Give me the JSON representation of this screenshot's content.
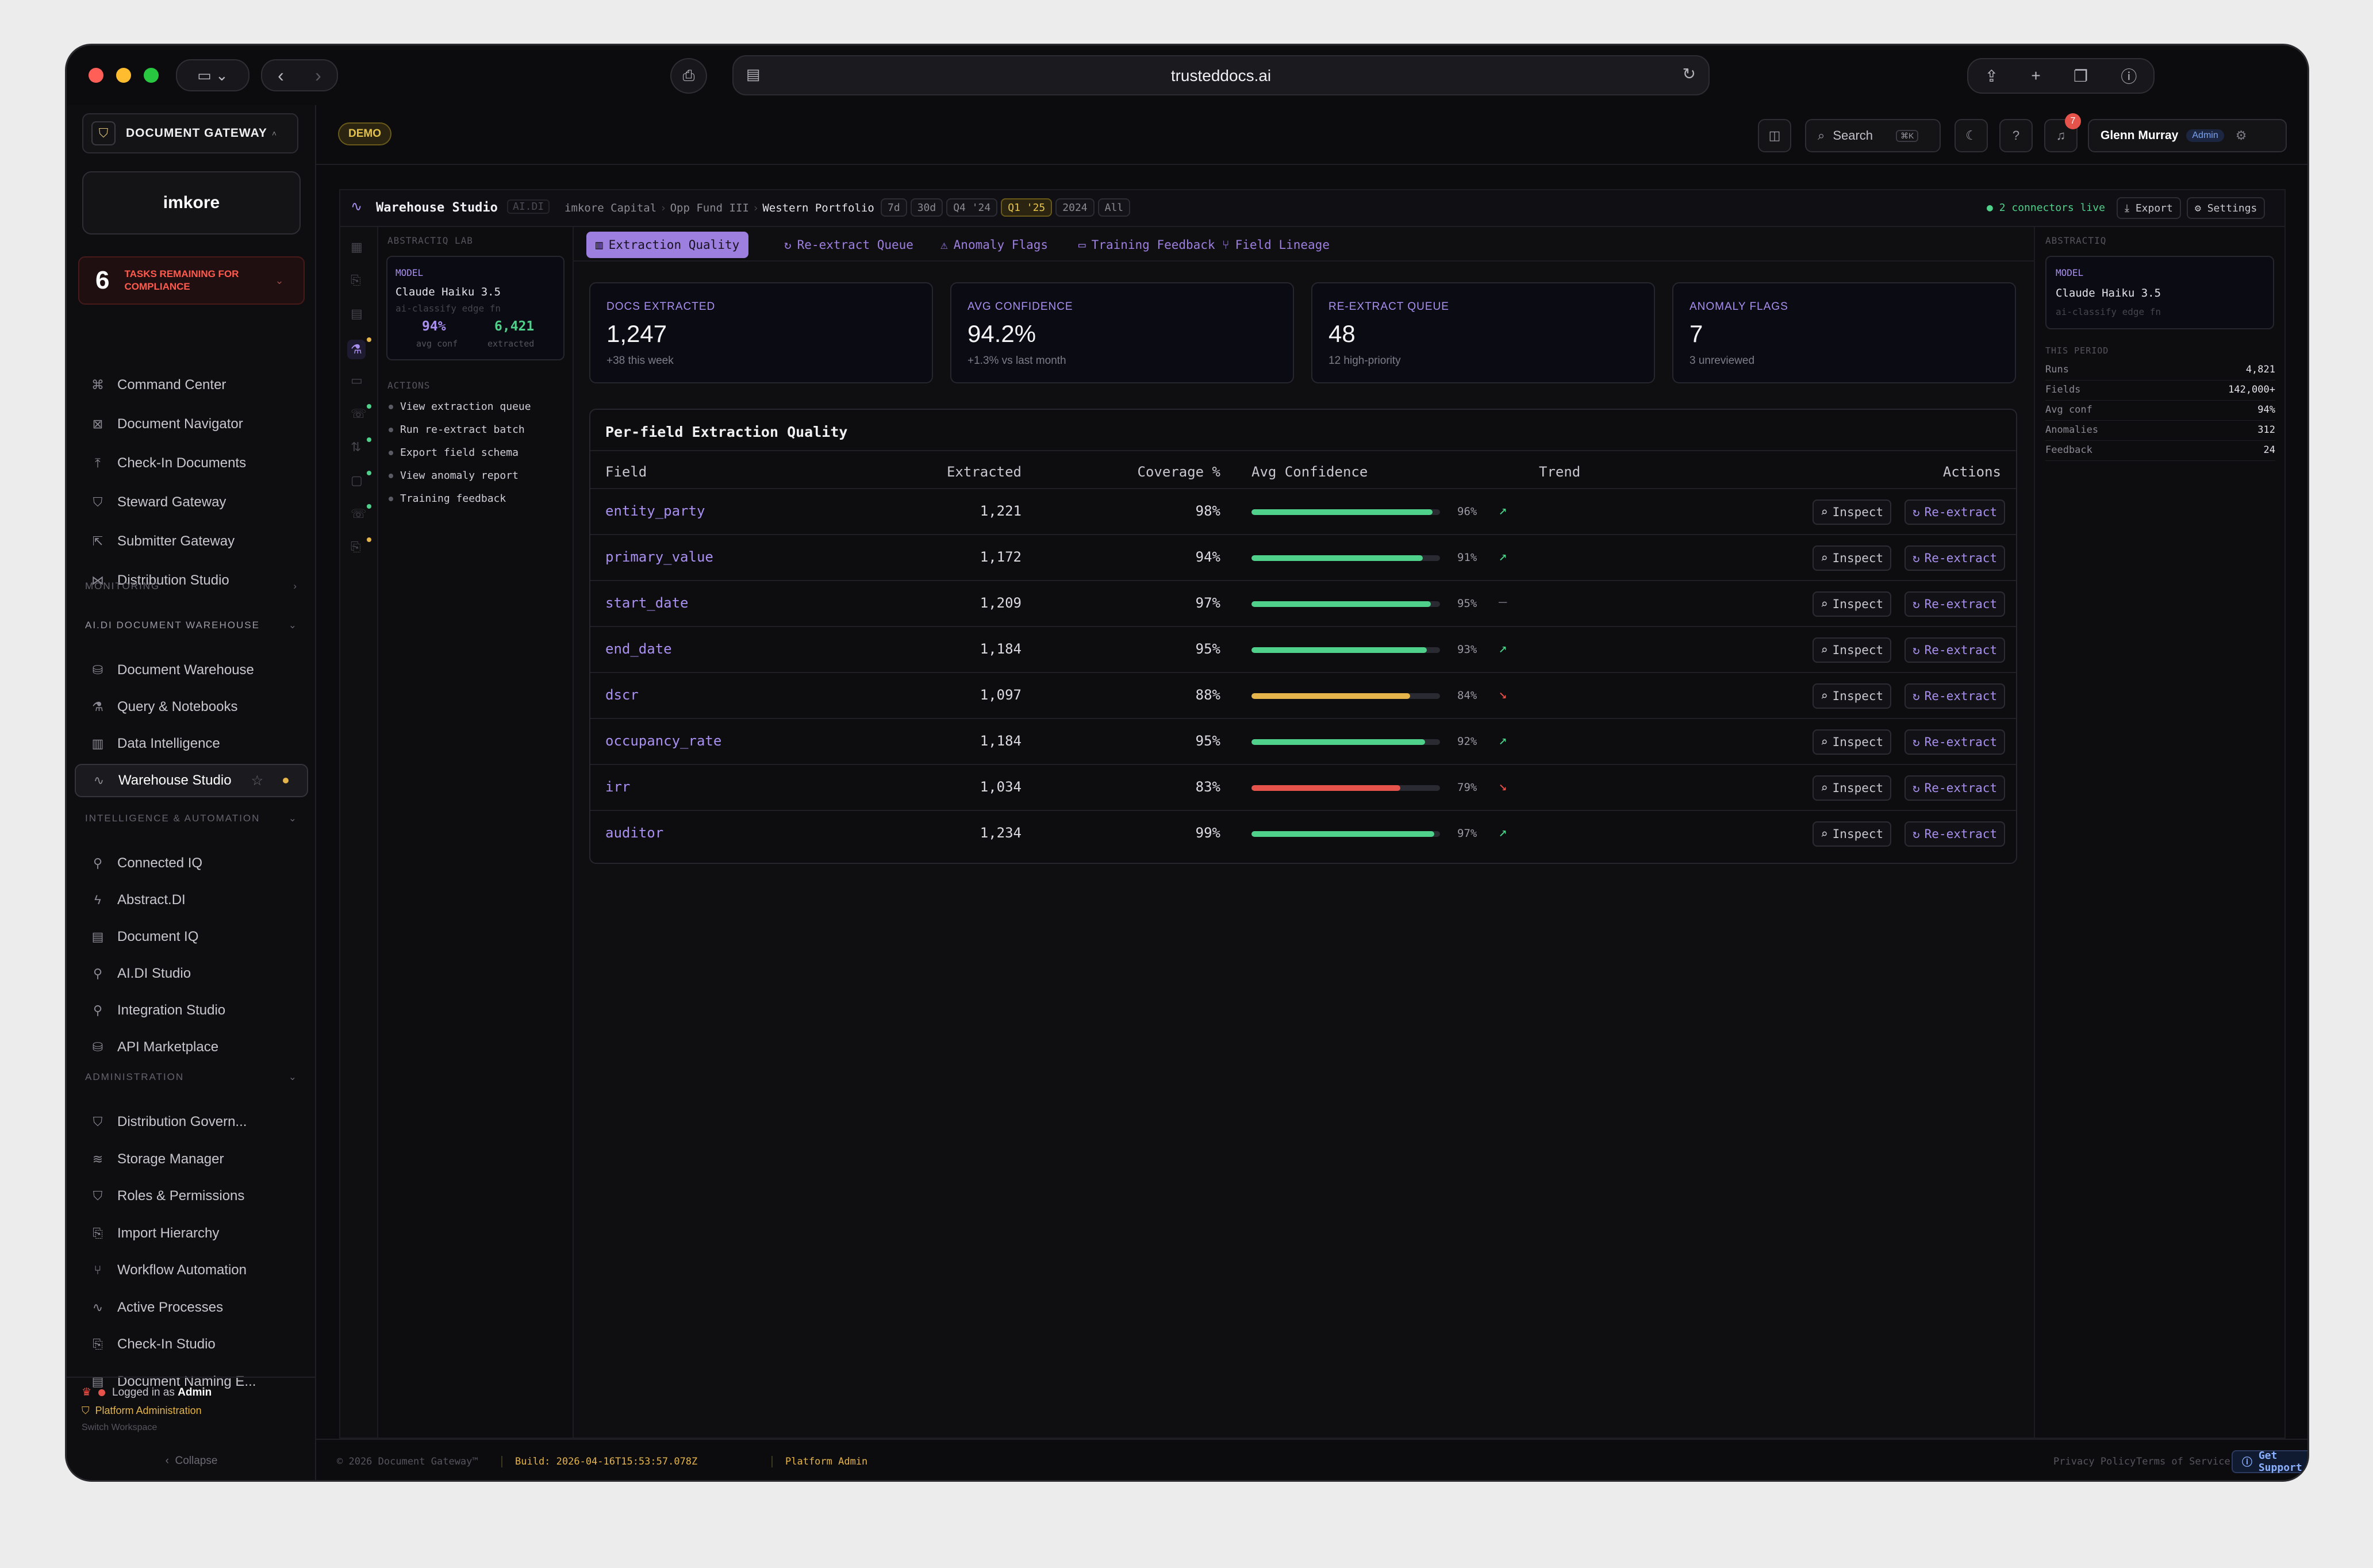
{
  "browser": {
    "url": "trusteddocs.ai"
  },
  "app": {
    "brand": "DOCUMENT GATEWAY",
    "env_badge": "DEMO",
    "logo_text": "imkore"
  },
  "tasks": {
    "count": "6",
    "label": "TASKS REMAINING FOR COMPLIANCE"
  },
  "nav": {
    "top_items": [
      "Command Center",
      "Document Navigator",
      "Check-In Documents",
      "Steward Gateway",
      "Submitter Gateway",
      "Distribution Studio"
    ],
    "monitoring_label": "MONITORING",
    "warehouse_label": "AI.DI DOCUMENT WAREHOUSE",
    "warehouse_items": [
      "Document Warehouse",
      "Query & Notebooks",
      "Data Intelligence",
      "Warehouse Studio"
    ],
    "intel_label": "INTELLIGENCE & AUTOMATION",
    "intel_items": [
      "Connected IQ",
      "Abstract.DI",
      "Document IQ",
      "AI.DI Studio",
      "Integration Studio",
      "API Marketplace"
    ],
    "admin_label": "ADMINISTRATION",
    "admin_items": [
      "Distribution Govern...",
      "Storage Manager",
      "Roles & Permissions",
      "Import Hierarchy",
      "Workflow Automation",
      "Active Processes",
      "Check-In Studio",
      "Document Naming E..."
    ],
    "logged_in_prefix": "Logged in as",
    "logged_in_role": "Admin",
    "platform_admin": "Platform Administration",
    "switch_workspace": "Switch Workspace",
    "collapse": "Collapse"
  },
  "topbar": {
    "search": "Search",
    "search_kbd": "⌘K",
    "notif_count": "7",
    "user_name": "Glenn Murray",
    "user_role": "Admin"
  },
  "workspace": {
    "title": "Warehouse Studio",
    "tag": "AI.DI",
    "crumbs": [
      "imkore Capital",
      "Opp Fund III",
      "Western Portfolio"
    ],
    "periods": [
      "7d",
      "30d",
      "Q4 '24",
      "Q1 '25",
      "2024",
      "All"
    ],
    "active_period": "Q1 '25",
    "connectors": "2 connectors live",
    "export": "Export",
    "settings": "Settings"
  },
  "lab": {
    "header": "ABSTRACTIQ LAB",
    "model_label": "MODEL",
    "model_name": "Claude Haiku 3.5",
    "model_sub": "ai-classify edge fn",
    "avg_conf": "94%",
    "avg_conf_label": "avg conf",
    "extracted": "6,421",
    "extracted_label": "extracted",
    "actions_label": "ACTIONS",
    "actions": [
      "View extraction queue",
      "Run re-extract batch",
      "Export field schema",
      "View anomaly report",
      "Training feedback"
    ]
  },
  "tabs": [
    "Extraction Quality",
    "Re-extract Queue",
    "Anomaly Flags",
    "Training Feedback",
    "Field Lineage"
  ],
  "cards": [
    {
      "label": "DOCS EXTRACTED",
      "value": "1,247",
      "sub": "+38 this week"
    },
    {
      "label": "AVG CONFIDENCE",
      "value": "94.2%",
      "sub": "+1.3% vs last month"
    },
    {
      "label": "RE-EXTRACT QUEUE",
      "value": "48",
      "sub": "12 high-priority"
    },
    {
      "label": "ANOMALY FLAGS",
      "value": "7",
      "sub": "3 unreviewed"
    }
  ],
  "table": {
    "title": "Per-field Extraction Quality",
    "headers": [
      "Field",
      "Extracted",
      "Coverage %",
      "Avg Confidence",
      "Trend",
      "Actions"
    ],
    "inspect_label": "Inspect",
    "reextract_label": "Re-extract",
    "rows": [
      {
        "field": "entity_party",
        "extracted": "1,221",
        "coverage": "98%",
        "confidence": 96,
        "conf_text": "96%",
        "trend": "up",
        "color": "#4fd18b"
      },
      {
        "field": "primary_value",
        "extracted": "1,172",
        "coverage": "94%",
        "confidence": 91,
        "conf_text": "91%",
        "trend": "up",
        "color": "#4fd18b"
      },
      {
        "field": "start_date",
        "extracted": "1,209",
        "coverage": "97%",
        "confidence": 95,
        "conf_text": "95%",
        "trend": "flat",
        "color": "#4fd18b"
      },
      {
        "field": "end_date",
        "extracted": "1,184",
        "coverage": "95%",
        "confidence": 93,
        "conf_text": "93%",
        "trend": "up",
        "color": "#4fd18b"
      },
      {
        "field": "dscr",
        "extracted": "1,097",
        "coverage": "88%",
        "confidence": 84,
        "conf_text": "84%",
        "trend": "down",
        "color": "#e5b44a"
      },
      {
        "field": "occupancy_rate",
        "extracted": "1,184",
        "coverage": "95%",
        "confidence": 92,
        "conf_text": "92%",
        "trend": "up",
        "color": "#4fd18b"
      },
      {
        "field": "irr",
        "extracted": "1,034",
        "coverage": "83%",
        "confidence": 79,
        "conf_text": "79%",
        "trend": "down",
        "color": "#e5534b"
      },
      {
        "field": "auditor",
        "extracted": "1,234",
        "coverage": "99%",
        "confidence": 97,
        "conf_text": "97%",
        "trend": "up",
        "color": "#4fd18b"
      }
    ]
  },
  "right_panel": {
    "header": "ABSTRACTIQ",
    "model_label": "MODEL",
    "model_name": "Claude Haiku 3.5",
    "model_sub": "ai-classify edge fn",
    "period_label": "THIS PERIOD",
    "stats": [
      {
        "k": "Runs",
        "v": "4,821"
      },
      {
        "k": "Fields",
        "v": "142,000+"
      },
      {
        "k": "Avg conf",
        "v": "94%"
      },
      {
        "k": "Anomalies",
        "v": "312"
      },
      {
        "k": "Feedback",
        "v": "24"
      }
    ]
  },
  "footer": {
    "copyright": "© 2026 Document Gateway™",
    "build": "Build: 2026-04-16T15:53:57.078Z",
    "platform": "Platform Admin",
    "privacy": "Privacy Policy",
    "terms": "Terms of Service",
    "support": "Get Support"
  },
  "colors": {
    "accent": "#a990f0",
    "warning": "#e5b44a",
    "danger": "#e5534b",
    "success": "#4fd18b"
  }
}
